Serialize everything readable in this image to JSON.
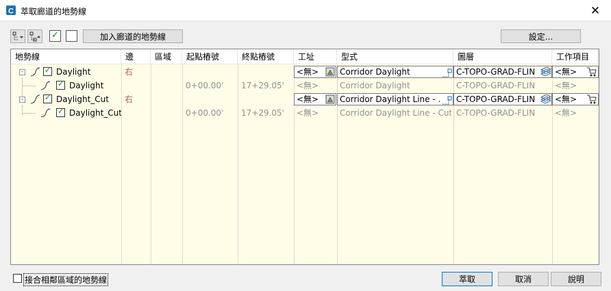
{
  "window": {
    "title": "萃取廊道的地勢線",
    "close_glyph": "✕"
  },
  "toolbar": {
    "add_button": "加入廊道的地勢線",
    "settings_button": "設定..."
  },
  "table": {
    "columns": [
      "地勢線",
      "邊",
      "區域",
      "起點樁號",
      "終點樁號",
      "工址",
      "型式",
      "圖層",
      "工作項目"
    ],
    "rows": [
      {
        "name": "Daylight",
        "side": "右",
        "region": "",
        "start": "",
        "end": "",
        "site": "<無>",
        "style": "Corridor Daylight",
        "layer": "C-TOPO-GRAD-FLIN",
        "pay_item": "<無>",
        "level": 0
      },
      {
        "name": "Daylight",
        "side": "",
        "region": "",
        "start": "0+00.00'",
        "end": "17+29.05'",
        "site": "<無>",
        "style": "Corridor Daylight",
        "layer": "C-TOPO-GRAD-FLIN",
        "pay_item": "<無>",
        "level": 1
      },
      {
        "name": "Daylight_Cut",
        "side": "右",
        "region": "",
        "start": "",
        "end": "",
        "site": "<無>",
        "style": "Corridor Daylight Line - ...",
        "layer": "C-TOPO-GRAD-FLIN",
        "pay_item": "<無>",
        "level": 0
      },
      {
        "name": "Daylight_Cut",
        "side": "",
        "region": "",
        "start": "0+00.00'",
        "end": "17+29.05'",
        "site": "<無>",
        "style": "Corridor Daylight Line - Cut",
        "layer": "C-TOPO-GRAD-FLIN",
        "pay_item": "<無>",
        "level": 1
      }
    ]
  },
  "footer": {
    "merge_checkbox_label": "接合相鄰區域的地勢線",
    "extract_button": "萃取",
    "cancel_button": "取消",
    "help_button": "說明"
  },
  "colors": {
    "grid_background": "#fffde8",
    "checkbox_green": "#0a8a0a",
    "accent_blue": "#0078d7"
  }
}
